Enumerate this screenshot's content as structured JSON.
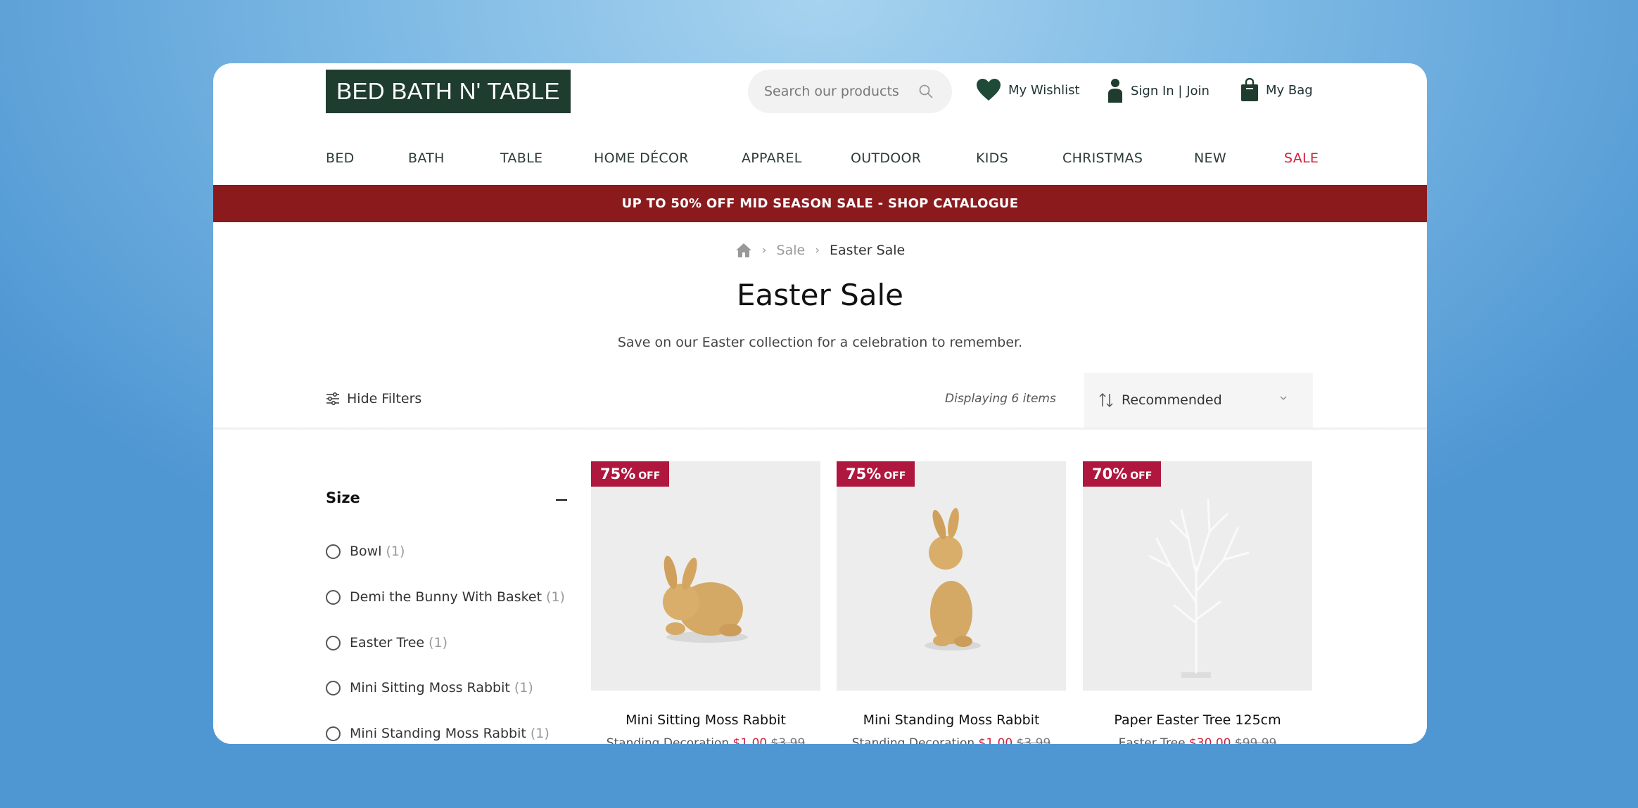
{
  "header": {
    "logo": "BED BATH N' TABLE",
    "search_placeholder": "Search our products",
    "wishlist": "My Wishlist",
    "signin": "Sign In | Join",
    "bag": "My Bag"
  },
  "nav": [
    "BED",
    "BATH",
    "TABLE",
    "HOME DÉCOR",
    "APPAREL",
    "OUTDOOR",
    "KIDS",
    "CHRISTMAS",
    "NEW",
    "SALE"
  ],
  "banner": "UP TO 50% OFF MID SEASON SALE - SHOP CATALOGUE",
  "breadcrumb": {
    "level1": "Sale",
    "current": "Easter Sale"
  },
  "page": {
    "title": "Easter Sale",
    "subtitle": "Save on our Easter collection for a celebration to remember."
  },
  "toolbar": {
    "hide_filters": "Hide Filters",
    "count": "Displaying 6 items",
    "sort": "Recommended"
  },
  "filters": {
    "title": "Size",
    "options": [
      {
        "label": "Bowl",
        "count": "(1)"
      },
      {
        "label": "Demi the Bunny With Basket",
        "count": "(1)"
      },
      {
        "label": "Easter Tree",
        "count": "(1)"
      },
      {
        "label": "Mini Sitting Moss Rabbit",
        "count": "(1)"
      },
      {
        "label": "Mini Standing Moss Rabbit",
        "count": "(1)"
      }
    ]
  },
  "products": [
    {
      "badge_pct": "75%",
      "badge_off": "OFF",
      "name": "Mini Sitting Moss Rabbit",
      "category": "Standing Decoration",
      "price": "$1.00",
      "was": "$3.99"
    },
    {
      "badge_pct": "75%",
      "badge_off": "OFF",
      "name": "Mini Standing Moss Rabbit",
      "category": "Standing Decoration",
      "price": "$1.00",
      "was": "$3.99"
    },
    {
      "badge_pct": "70%",
      "badge_off": "OFF",
      "name": "Paper Easter Tree 125cm",
      "category": "Easter Tree",
      "price": "$30.00",
      "was": "$99.99"
    }
  ],
  "colors": {
    "brand_green": "#1f3d2f",
    "banner_red": "#8b1a1d",
    "sale_red": "#d0203b",
    "badge": "#b0173f"
  }
}
